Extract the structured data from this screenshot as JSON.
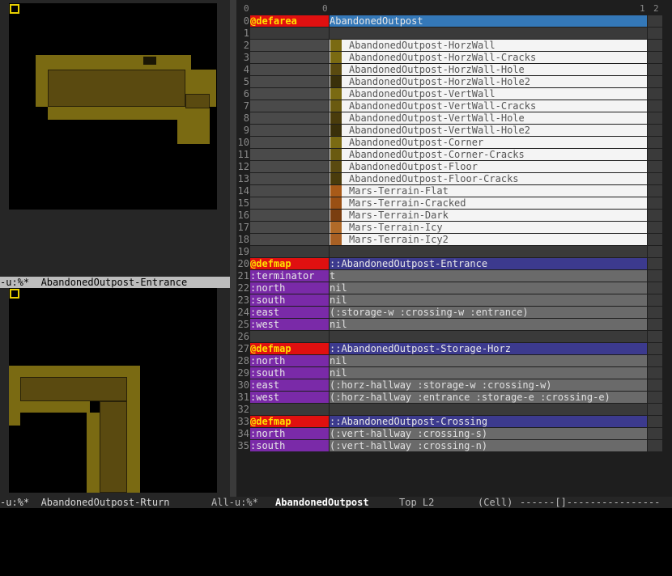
{
  "left_top": {
    "modeline": "-u:%*  AbandonedOutpost-Entrance"
  },
  "left_bottom": {
    "modeline": "-u:%*  AbandonedOutpost-Rturn"
  },
  "right": {
    "col_headers": [
      "0",
      "0",
      "1",
      "2"
    ],
    "rows": [
      {
        "n": "0",
        "c0": "@defarea",
        "c1": "AbandonedOutpost",
        "style": "area"
      },
      {
        "n": "1",
        "c0": "",
        "c1": "",
        "style": "blank"
      },
      {
        "n": "2",
        "c0": "",
        "c1": "AbandonedOutpost-HorzWall",
        "style": "tile",
        "swatch": "#7a6a12"
      },
      {
        "n": "3",
        "c0": "",
        "c1": "AbandonedOutpost-HorzWall-Cracks",
        "style": "tile",
        "swatch": "#7a6a12"
      },
      {
        "n": "4",
        "c0": "",
        "c1": "AbandonedOutpost-HorzWall-Hole",
        "style": "tile",
        "swatch": "#5a4a10"
      },
      {
        "n": "5",
        "c0": "",
        "c1": "AbandonedOutpost-HorzWall-Hole2",
        "style": "tile",
        "swatch": "#3a300a"
      },
      {
        "n": "6",
        "c0": "",
        "c1": "AbandonedOutpost-VertWall",
        "style": "tile",
        "swatch": "#7a6a12"
      },
      {
        "n": "7",
        "c0": "",
        "c1": "AbandonedOutpost-VertWall-Cracks",
        "style": "tile",
        "swatch": "#6a5a10"
      },
      {
        "n": "8",
        "c0": "",
        "c1": "AbandonedOutpost-VertWall-Hole",
        "style": "tile",
        "swatch": "#4a3c0c"
      },
      {
        "n": "9",
        "c0": "",
        "c1": "AbandonedOutpost-VertWall-Hole2",
        "style": "tile",
        "swatch": "#3a300a"
      },
      {
        "n": "10",
        "c0": "",
        "c1": "AbandonedOutpost-Corner",
        "style": "tile",
        "swatch": "#7a6a12"
      },
      {
        "n": "11",
        "c0": "",
        "c1": "AbandonedOutpost-Corner-Cracks",
        "style": "tile",
        "swatch": "#6a5a10"
      },
      {
        "n": "12",
        "c0": "",
        "c1": "AbandonedOutpost-Floor",
        "style": "tile",
        "swatch": "#5a4a10"
      },
      {
        "n": "13",
        "c0": "",
        "c1": "AbandonedOutpost-Floor-Cracks",
        "style": "tile",
        "swatch": "#4a3c0c"
      },
      {
        "n": "14",
        "c0": "",
        "c1": "Mars-Terrain-Flat",
        "style": "tile",
        "swatch": "#a85a18"
      },
      {
        "n": "15",
        "c0": "",
        "c1": "Mars-Terrain-Cracked",
        "style": "tile",
        "swatch": "#9a5014"
      },
      {
        "n": "16",
        "c0": "",
        "c1": "Mars-Terrain-Dark",
        "style": "tile",
        "swatch": "#7a3e10"
      },
      {
        "n": "17",
        "c0": "",
        "c1": "Mars-Terrain-Icy",
        "style": "tile",
        "swatch": "#b06a28"
      },
      {
        "n": "18",
        "c0": "",
        "c1": "Mars-Terrain-Icy2",
        "style": "tile",
        "swatch": "#a86024"
      },
      {
        "n": "19",
        "c0": "",
        "c1": "",
        "style": "blank"
      },
      {
        "n": "20",
        "c0": "@defmap",
        "c1": "::AbandonedOutpost-Entrance",
        "style": "map"
      },
      {
        "n": "21",
        "c0": ":terminator",
        "c1": "t",
        "style": "prop"
      },
      {
        "n": "22",
        "c0": ":north",
        "c1": "nil",
        "style": "prop"
      },
      {
        "n": "23",
        "c0": ":south",
        "c1": "nil",
        "style": "prop"
      },
      {
        "n": "24",
        "c0": ":east",
        "c1": "(:storage-w :crossing-w :entrance)",
        "style": "prop"
      },
      {
        "n": "25",
        "c0": ":west",
        "c1": "nil",
        "style": "prop"
      },
      {
        "n": "26",
        "c0": "",
        "c1": "",
        "style": "blank"
      },
      {
        "n": "27",
        "c0": "@defmap",
        "c1": "::AbandonedOutpost-Storage-Horz",
        "style": "map"
      },
      {
        "n": "28",
        "c0": ":north",
        "c1": "nil",
        "style": "prop"
      },
      {
        "n": "29",
        "c0": ":south",
        "c1": "nil",
        "style": "prop"
      },
      {
        "n": "30",
        "c0": ":east",
        "c1": "(:horz-hallway :storage-w :crossing-w)",
        "style": "prop"
      },
      {
        "n": "31",
        "c0": ":west",
        "c1": "(:horz-hallway :entrance :storage-e :crossing-e)",
        "style": "prop"
      },
      {
        "n": "32",
        "c0": "",
        "c1": "",
        "style": "blank"
      },
      {
        "n": "33",
        "c0": "@defmap",
        "c1": "::AbandonedOutpost-Crossing",
        "style": "map"
      },
      {
        "n": "34",
        "c0": ":north",
        "c1": "(:vert-hallway :crossing-s)",
        "style": "prop"
      },
      {
        "n": "35",
        "c0": ":south",
        "c1": "(:vert-hallway :crossing-n)",
        "style": "prop"
      }
    ]
  },
  "bottom_modeline": {
    "left": "-u:%*  AbandonedOutpost-Rturn",
    "mode": "All-u:%*",
    "buffer": "AbandonedOutpost",
    "pos": "Top L2",
    "cell": "(Cell)",
    "fill": "------[]----------------"
  },
  "colors": {
    "keyword_red": "#e01010",
    "keyword_purple": "#7a2aa8",
    "area_blue": "#3478b8",
    "map_indigo": "#3c3a8e"
  }
}
